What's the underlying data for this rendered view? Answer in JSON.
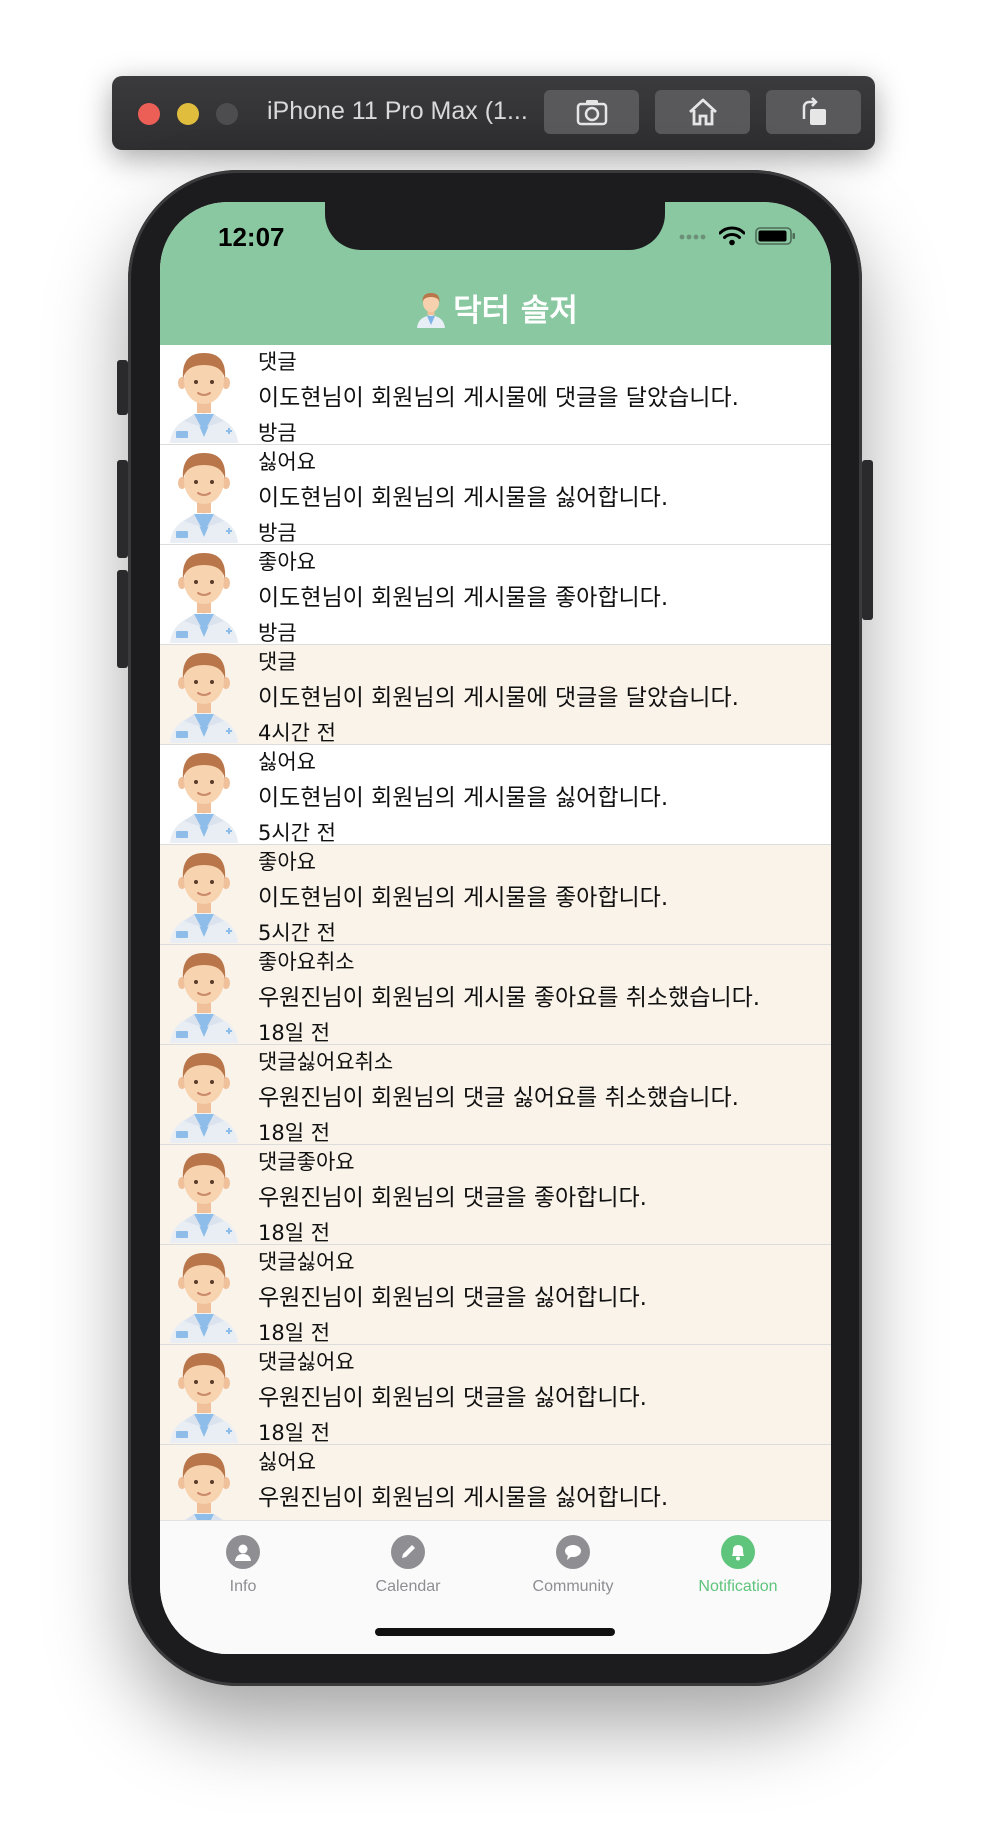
{
  "window": {
    "title": "iPhone 11 Pro Max (1..."
  },
  "status_bar": {
    "time": "12:07"
  },
  "header": {
    "title": "닥터 솔저"
  },
  "notifications": [
    {
      "type": "댓글",
      "message": "이도현님이 회원님의 게시물에 댓글을 달았습니다.",
      "time": "방금",
      "read": true
    },
    {
      "type": "싫어요",
      "message": "이도현님이 회원님의 게시물을 싫어합니다.",
      "time": "방금",
      "read": true
    },
    {
      "type": "좋아요",
      "message": "이도현님이 회원님의 게시물을 좋아합니다.",
      "time": "방금",
      "read": true
    },
    {
      "type": "댓글",
      "message": "이도현님이 회원님의 게시물에 댓글을 달았습니다.",
      "time": "4시간 전",
      "read": false
    },
    {
      "type": "싫어요",
      "message": "이도현님이 회원님의 게시물을 싫어합니다.",
      "time": "5시간 전",
      "read": true
    },
    {
      "type": "좋아요",
      "message": "이도현님이 회원님의 게시물을 좋아합니다.",
      "time": "5시간 전",
      "read": false
    },
    {
      "type": "좋아요취소",
      "message": "우원진님이 회원님의 게시물 좋아요를 취소했습니다.",
      "time": "18일 전",
      "read": false
    },
    {
      "type": "댓글싫어요취소",
      "message": "우원진님이 회원님의 댓글 싫어요를 취소했습니다.",
      "time": "18일 전",
      "read": false
    },
    {
      "type": "댓글좋아요",
      "message": "우원진님이 회원님의 댓글을 좋아합니다.",
      "time": "18일 전",
      "read": false
    },
    {
      "type": "댓글싫어요",
      "message": "우원진님이 회원님의 댓글을 싫어합니다.",
      "time": "18일 전",
      "read": false
    },
    {
      "type": "댓글싫어요",
      "message": "우원진님이 회원님의 댓글을 싫어합니다.",
      "time": "18일 전",
      "read": false
    },
    {
      "type": "싫어요",
      "message": "우원진님이 회원님의 게시물을 싫어합니다.",
      "time": "",
      "read": false
    }
  ],
  "tabs": [
    {
      "label": "Info",
      "icon": "person-icon",
      "active": false
    },
    {
      "label": "Calendar",
      "icon": "pencil-icon",
      "active": false
    },
    {
      "label": "Community",
      "icon": "chat-bubble-icon",
      "active": false
    },
    {
      "label": "Notification",
      "icon": "bell-icon",
      "active": true
    }
  ],
  "colors": {
    "header": "#89c8a0",
    "unread_row": "#faf3ea",
    "read_row": "#ffffff",
    "tab_active": "#5fc47c",
    "tab_inactive": "#8e8e93"
  }
}
